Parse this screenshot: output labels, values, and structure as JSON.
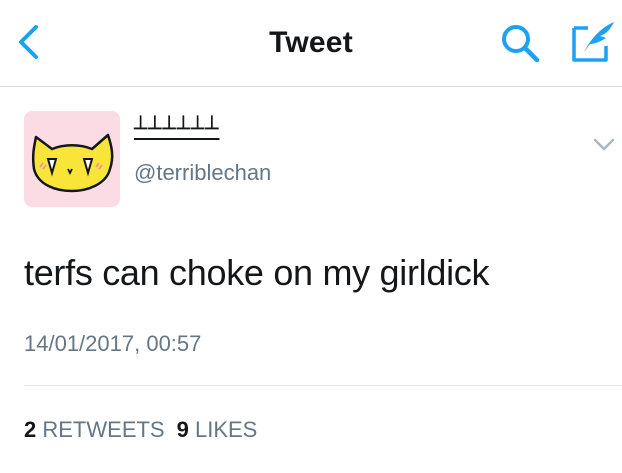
{
  "header": {
    "title": "Tweet",
    "accent_color": "#1da1f2",
    "icons": {
      "back": "chevron-left-icon",
      "search": "search-icon",
      "compose": "compose-icon"
    }
  },
  "tweet": {
    "display_name": "┴┴┴┴┴┴",
    "handle": "@terriblechan",
    "text": "terfs can choke on my girldick",
    "timestamp": "14/01/2017, 00:57",
    "avatar": {
      "icon": "cat-face-avatar",
      "background": "#fbdce5"
    }
  },
  "stats": {
    "retweets_count": "2",
    "retweets_label": "RETWEETS",
    "likes_count": "9",
    "likes_label": "LIKES"
  }
}
